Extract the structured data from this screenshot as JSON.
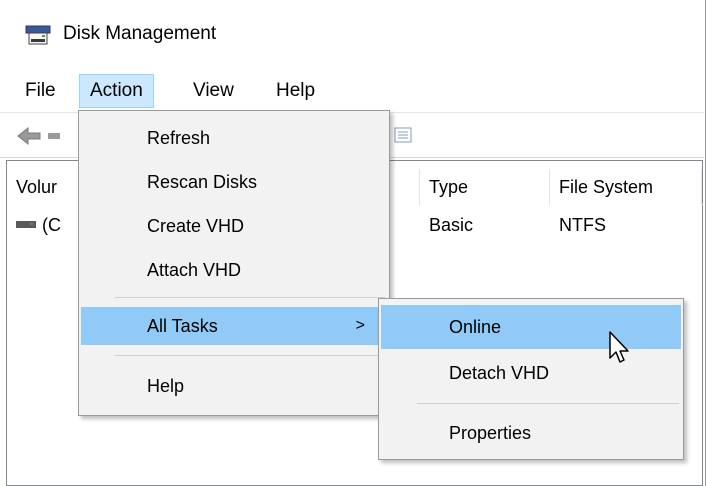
{
  "window": {
    "title": "Disk Management",
    "app_icon": "disk-management-icon"
  },
  "menubar": {
    "items": [
      {
        "label": "File"
      },
      {
        "label": "Action"
      },
      {
        "label": "View"
      },
      {
        "label": "Help"
      }
    ],
    "active_item": "Action"
  },
  "toolbar": {
    "icons": [
      "back-arrow-icon",
      "forward-arrow-icon",
      "properties-icon"
    ]
  },
  "table": {
    "columns": [
      {
        "label": "Volur"
      },
      {
        "label": "Type"
      },
      {
        "label": "File System"
      }
    ],
    "rows": [
      {
        "volume": "(C",
        "type": "Basic",
        "file_system": "NTFS"
      }
    ]
  },
  "action_menu": {
    "items": [
      {
        "label": "Refresh"
      },
      {
        "label": "Rescan Disks"
      },
      {
        "label": "Create VHD"
      },
      {
        "label": "Attach VHD"
      },
      {
        "label": "All Tasks",
        "has_submenu": true,
        "arrow": ">"
      },
      {
        "label": "Help"
      }
    ],
    "highlighted": "All Tasks"
  },
  "all_tasks_submenu": {
    "items": [
      {
        "label": "Online"
      },
      {
        "label": "Detach VHD"
      },
      {
        "label": "Properties"
      }
    ],
    "highlighted": "Online"
  },
  "colors": {
    "menu_highlight": "#91c9f7",
    "menubar_active": "#cce8ff",
    "menu_background": "#f2f2f2"
  }
}
